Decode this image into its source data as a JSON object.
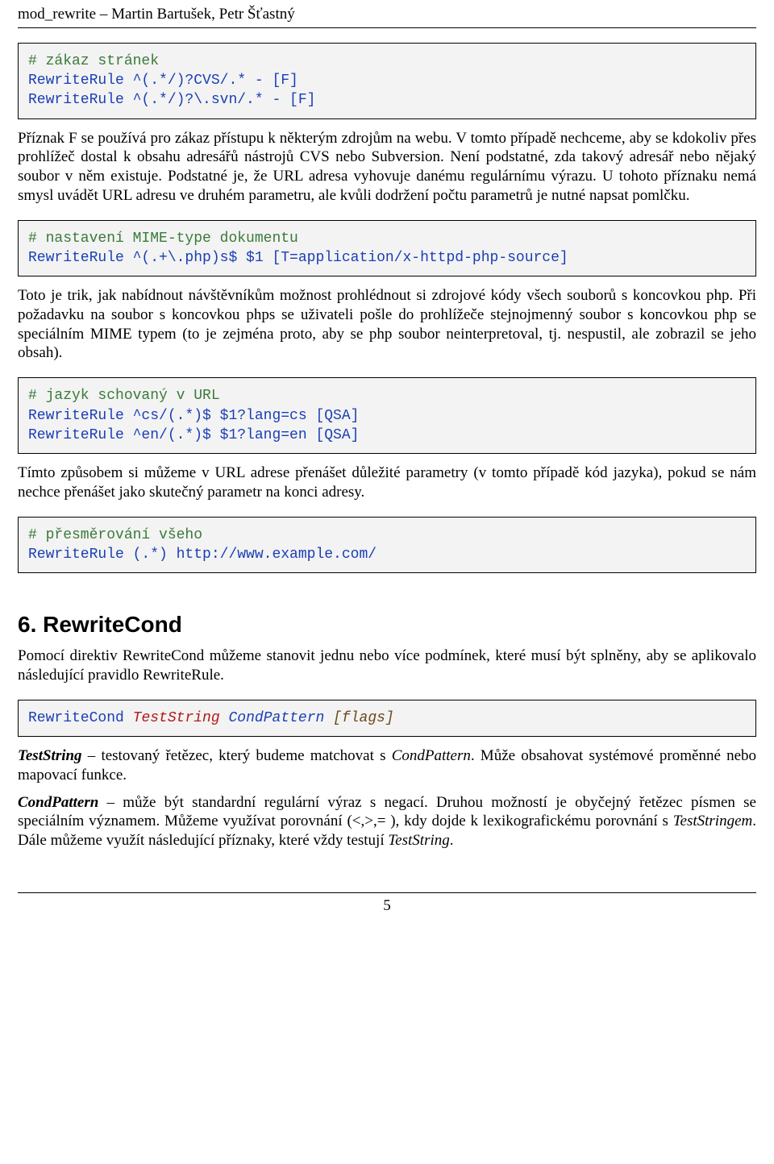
{
  "header": {
    "left": "mod_rewrite – Martin Bartušek, Petr Šťastný",
    "right": ""
  },
  "code1": {
    "comment": "# zákaz stránek",
    "line1": "RewriteRule ^(.*/)?CVS/.* - [F]",
    "line2": "RewriteRule ^(.*/)?\\.svn/.* - [F]"
  },
  "para1": "Příznak F se používá pro zákaz přístupu k některým zdrojům na webu. V tomto případě nechceme, aby se kdokoliv přes prohlížeč dostal k obsahu adresářů nástrojů CVS nebo Subversion. Není podstatné, zda takový adresář nebo nějaký soubor v něm existuje. Podstatné je, že URL adresa vyhovuje danému regulárnímu výrazu. U tohoto příznaku nemá smysl uvádět URL adresu ve druhém parametru, ale kvůli dodržení počtu parametrů je nutné napsat pomlčku.",
  "code2": {
    "comment": "# nastavení MIME-type dokumentu",
    "line1": "RewriteRule ^(.+\\.php)s$ $1 [T=application/x-httpd-php-source]"
  },
  "para2": "Toto je trik, jak nabídnout návštěvníkům možnost prohlédnout si zdrojové kódy všech souborů s koncovkou php. Při požadavku na soubor s koncovkou phps se uživateli pošle do prohlížeče stejnojmenný soubor s koncovkou php se speciálním MIME typem (to je zejména proto, aby se php soubor neinterpretoval, tj. nespustil, ale zobrazil se jeho obsah).",
  "code3": {
    "comment": "# jazyk schovaný v URL",
    "line1": "RewriteRule ^cs/(.*)$ $1?lang=cs [QSA]",
    "line2": "RewriteRule ^en/(.*)$ $1?lang=en [QSA]"
  },
  "para3": "Tímto způsobem si můžeme v URL adrese přenášet důležité parametry (v tomto případě kód jazyka), pokud se nám nechce přenášet jako skutečný parametr na konci adresy.",
  "code4": {
    "comment": "# přesměrování všeho",
    "line1": "RewriteRule (.*) http://www.example.com/"
  },
  "section_title": "6.  RewriteCond",
  "para4": "Pomocí direktiv RewriteCond můžeme stanovit jednu nebo více podmínek, které musí být splněny, aby se aplikovalo následující pravidlo RewriteRule.",
  "code5": {
    "directive": "RewriteCond",
    "a1": "TestString",
    "a2": "CondPattern",
    "a3": "[flags]"
  },
  "defs": {
    "t1_label": "TestString",
    "t1_rest": " – testovaný řetězec, který budeme matchovat s ",
    "t1_ital": "CondPattern",
    "t1_tail": ". Může obsahovat systémové proměnné nebo mapovací funkce.",
    "t2_label": "CondPattern",
    "t2_rest": " – může být standardní regulární výraz s negací. Druhou možností je obyčejný řetězec písmen se speciálním významem. Můžeme využívat porovnání (<,>,= ), kdy dojde k lexikografickému porovnání s ",
    "t2_ital": "TestStringem",
    "t2_tail": ". Dále můžeme využít následující příznaky, které vždy testují ",
    "t2_ital2": "TestString",
    "t2_period": "."
  },
  "footer": {
    "page": "5"
  }
}
